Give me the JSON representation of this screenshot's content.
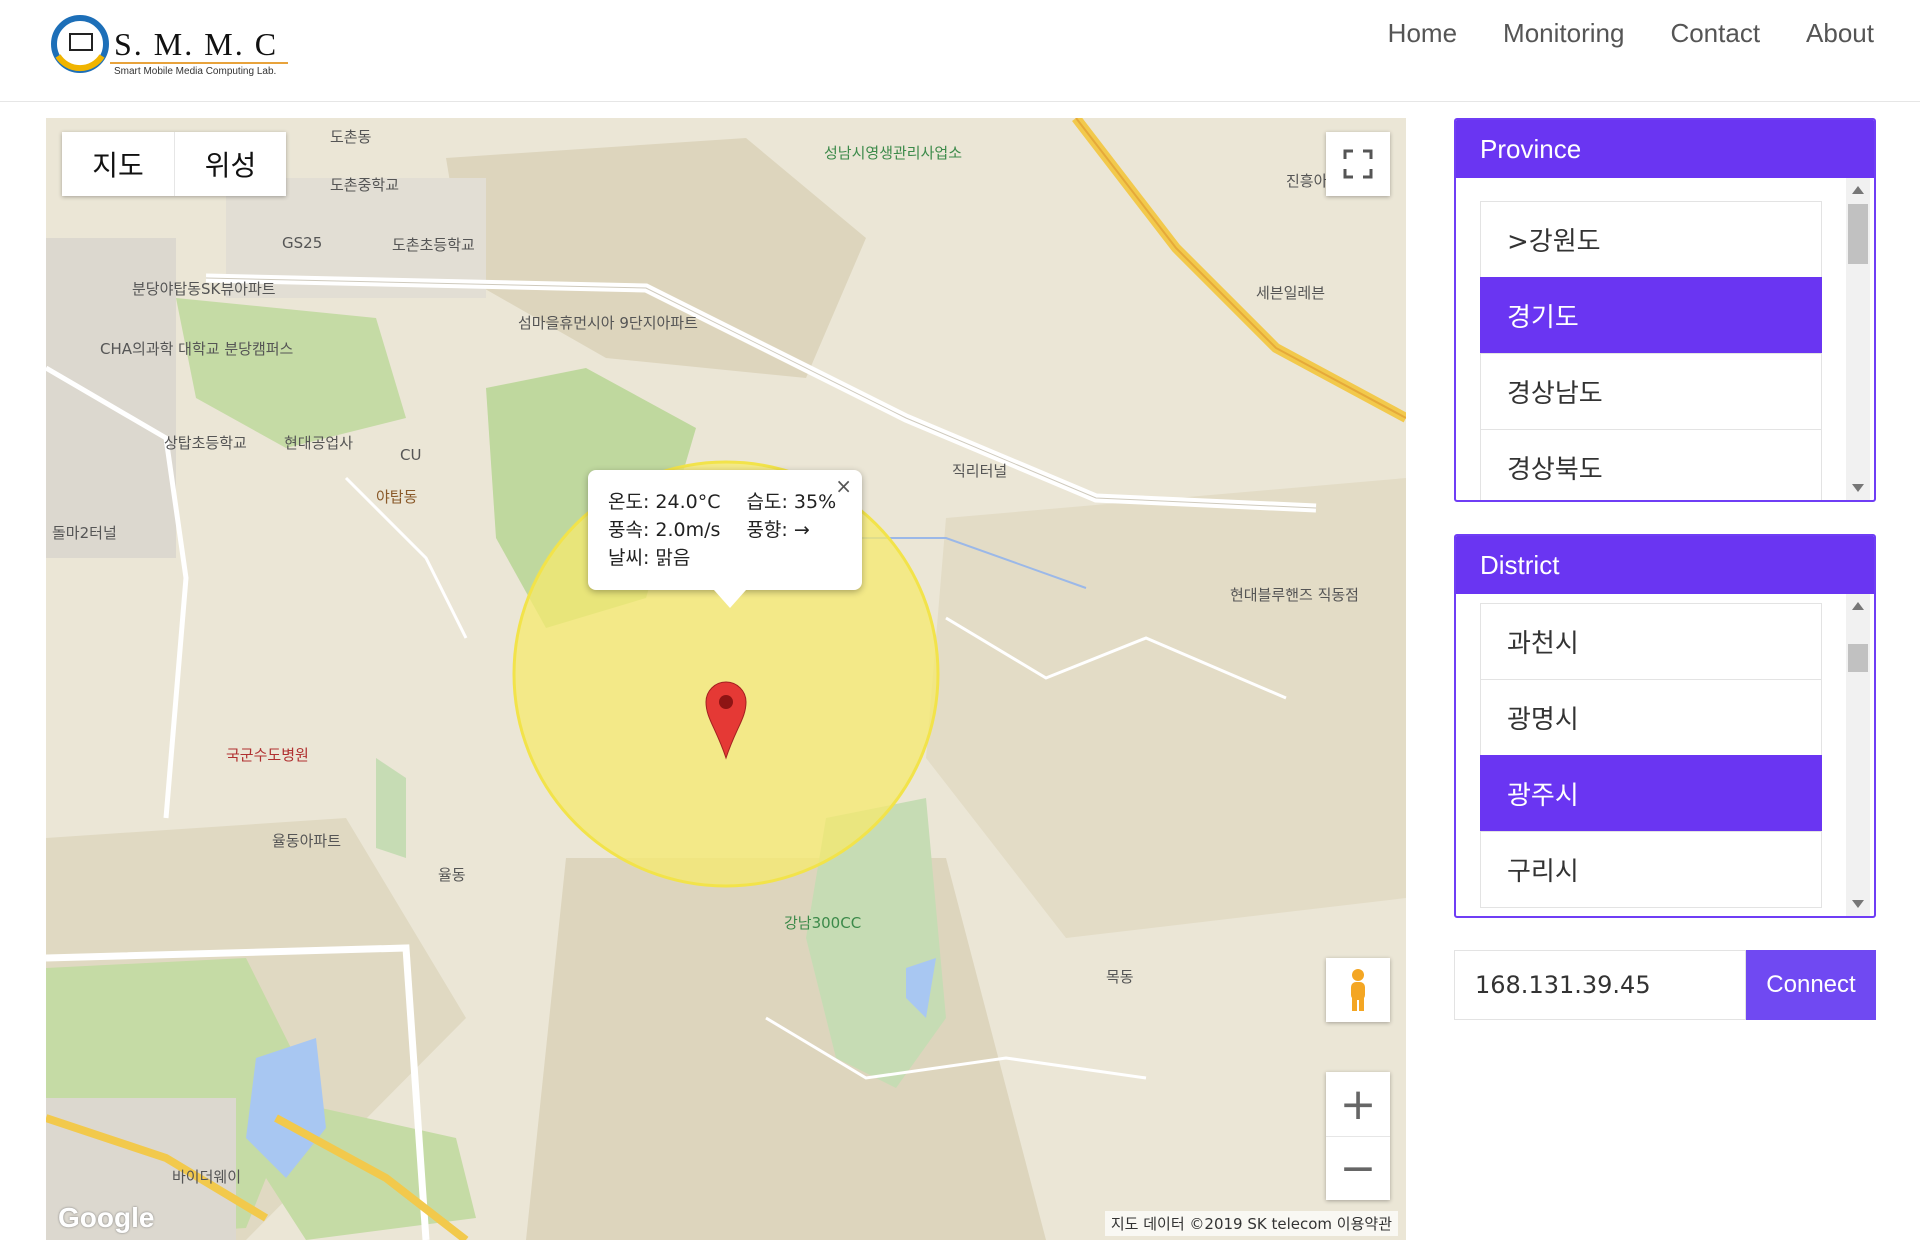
{
  "header": {
    "logo_title": "S. M. M. C",
    "logo_subtitle": "Smart Mobile Media Computing Lab.",
    "nav": [
      "Home",
      "Monitoring",
      "Contact",
      "About"
    ]
  },
  "map": {
    "type_buttons": [
      "지도",
      "위성"
    ],
    "labels": [
      "도촌동",
      "도촌중학교",
      "도촌초등학교",
      "GS25",
      "분당야탑동SK뷰아파트",
      "CHA의과학 대학교 분당캠퍼스",
      "섬마을휴먼시아 9단지아파트",
      "성남시영생관리사업소",
      "진흥아파트",
      "세븐일레븐",
      "상탑초등학교",
      "현대공업사",
      "CU",
      "야탑동",
      "직리터널",
      "현대블루핸즈 직동점",
      "국군수도병원",
      "율동아파트",
      "율동",
      "강남300CC",
      "바이더웨이",
      "돌마2터널",
      "목동"
    ],
    "info": {
      "temp_label": "온도:",
      "temp_value": "24.0°C",
      "humidity_label": "습도:",
      "humidity_value": "35%",
      "wind_label": "풍속:",
      "wind_value": "2.0m/s",
      "direction_label": "풍향:",
      "direction_value": "→",
      "weather_label": "날씨:",
      "weather_value": "맑음",
      "close": "×"
    },
    "attribution": "지도 데이터 ©2019 SK telecom   이용약관",
    "google": "Google"
  },
  "province": {
    "title": "Province",
    "items": [
      ">강원도",
      "경기도",
      "경상남도",
      "경상북도"
    ],
    "selected": "경기도"
  },
  "district": {
    "title": "District",
    "items": [
      "과천시",
      "광명시",
      "광주시",
      "구리시"
    ],
    "selected": "광주시"
  },
  "connect": {
    "ip_value": "168.131.39.45",
    "button": "Connect"
  },
  "colors": {
    "accent": "#6a35f2",
    "circle": "#f5ea6e"
  }
}
